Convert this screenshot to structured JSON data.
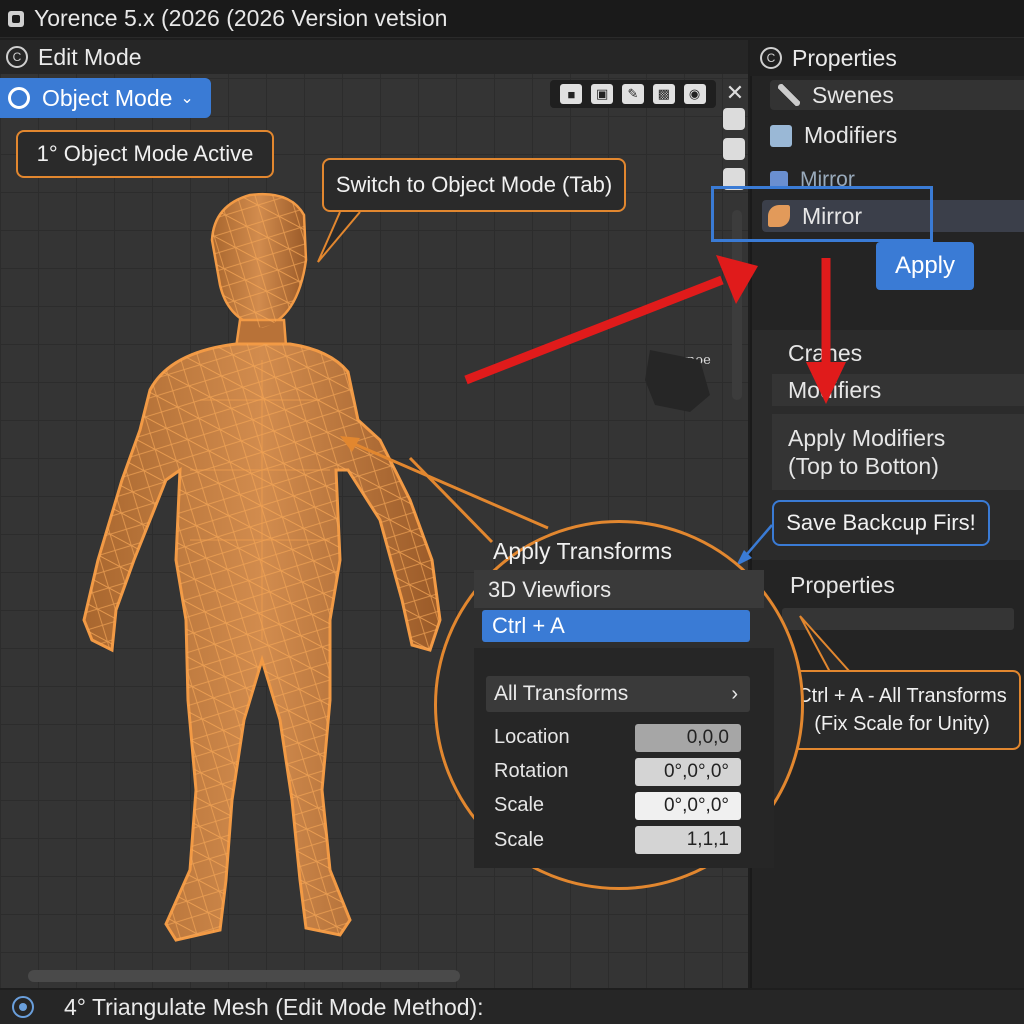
{
  "titlebar": {
    "title": "Yorence 5.x (2026 (2026 Version vetsion"
  },
  "viewport": {
    "header_label": "Edit Mode",
    "mode_selector": "Object Mode",
    "scene_label_line1": "Sarnoe",
    "scene_label_line2": "2ou1"
  },
  "callouts": {
    "object_mode_active": "1° Object Mode Active",
    "switch_mode": "Switch to Object Mode (Tab)",
    "save_backup": "Save Backcup Firs!",
    "ctrl_a_line1": "Ctrl + A - All Transforms",
    "ctrl_a_line2": "(Fix Scale for Unity)"
  },
  "properties": {
    "header_label": "Properties",
    "scenes": "Swenes",
    "modifiers": "Modifiers",
    "mirror_faded": "Mirror",
    "mirror": "Mirror",
    "apply_button": "Apply",
    "cranes": "Cranes",
    "modifiers2": "Modifiers",
    "apply_modifiers_line1": "Apply Modifiers",
    "apply_modifiers_line2": "(Top to Botton)",
    "properties2": "Properties"
  },
  "magnifier": {
    "title": "Apply Transforms",
    "subtitle": "3D Viewfiors",
    "shortcut": "Ctrl + A",
    "all_transforms": "All Transforms",
    "fields": [
      {
        "label": "Location",
        "value": "0,0,0"
      },
      {
        "label": "Rotation",
        "value": "0°,0°,0°"
      },
      {
        "label": "Scale",
        "value": "0°,0°,0°"
      },
      {
        "label": "Scale",
        "value": "1,1,1"
      }
    ]
  },
  "statusbar": {
    "text": "4° Triangulate Mesh (Edit Mode Method):"
  },
  "colors": {
    "accent": "#3a7bd5",
    "orange": "#e2872f",
    "arrow_red": "#e01b1b",
    "mesh_orange": "#c8823f"
  }
}
